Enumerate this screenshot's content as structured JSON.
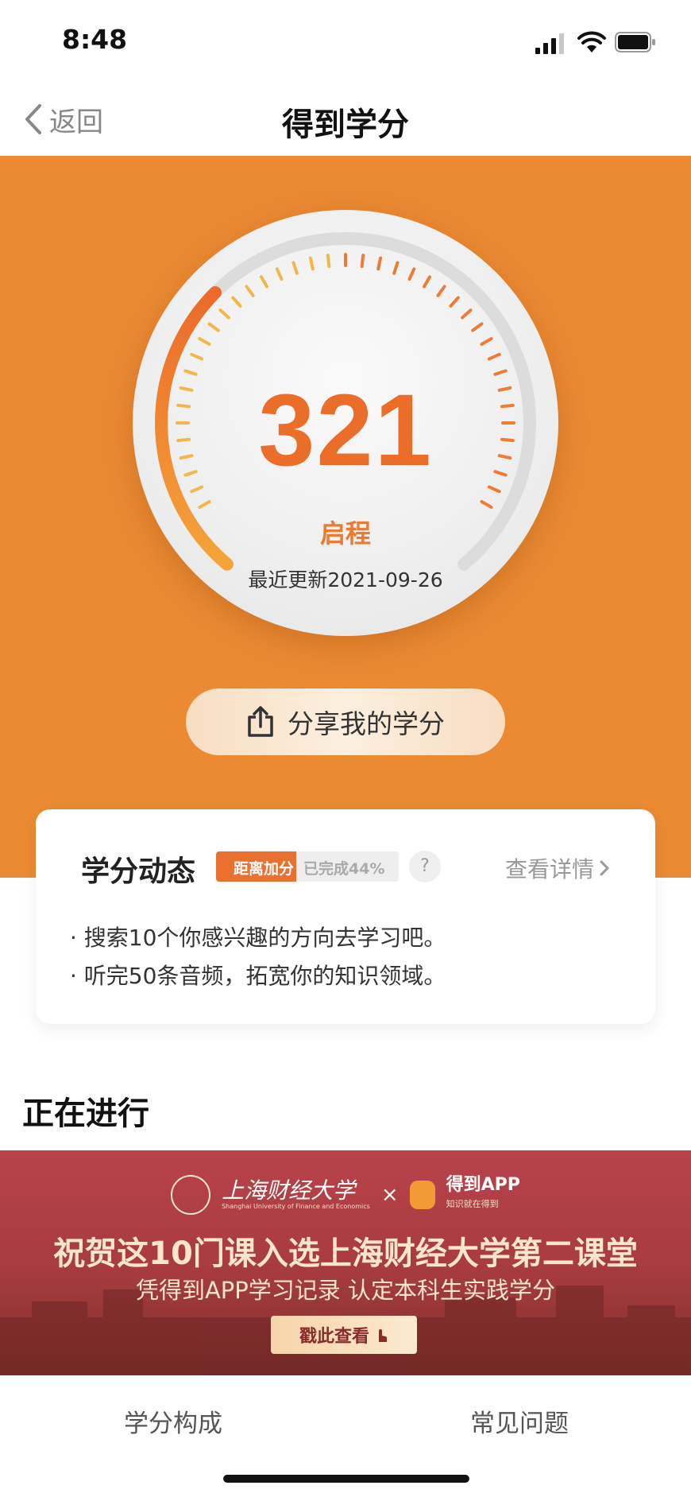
{
  "status_bar": {
    "time": "8:48"
  },
  "nav": {
    "back_label": "返回",
    "title": "得到学分"
  },
  "score": {
    "value": "321",
    "level": "启程",
    "updated": "最近更新2021-09-26"
  },
  "share": {
    "label": "分享我的学分"
  },
  "credit_card": {
    "title": "学分动态",
    "progress": {
      "label": "距离加分",
      "completed": "已完成44%",
      "percent": 44
    },
    "help": "?",
    "detail_label": "查看详情",
    "tips": [
      "· 搜索10个你感兴趣的方向去学习吧。",
      "· 听完50条音频，拓宽你的知识领域。"
    ]
  },
  "ongoing": {
    "title": "正在进行"
  },
  "banner": {
    "university": "上海财经大学",
    "university_en": "Shanghai University of Finance and Economics",
    "times": "×",
    "app": "得到APP",
    "app_slogan": "知识就在得到",
    "headline": "祝贺这10门课入选上海财经大学第二课堂",
    "subline": "凭得到APP学习记录  认定本科生实践学分",
    "button": "戳此查看"
  },
  "tabs": [
    "学分构成",
    "常见问题"
  ],
  "colors": {
    "accent": "#eb8a33",
    "score": "#ea6e2a",
    "banner": "#a63b3e"
  }
}
